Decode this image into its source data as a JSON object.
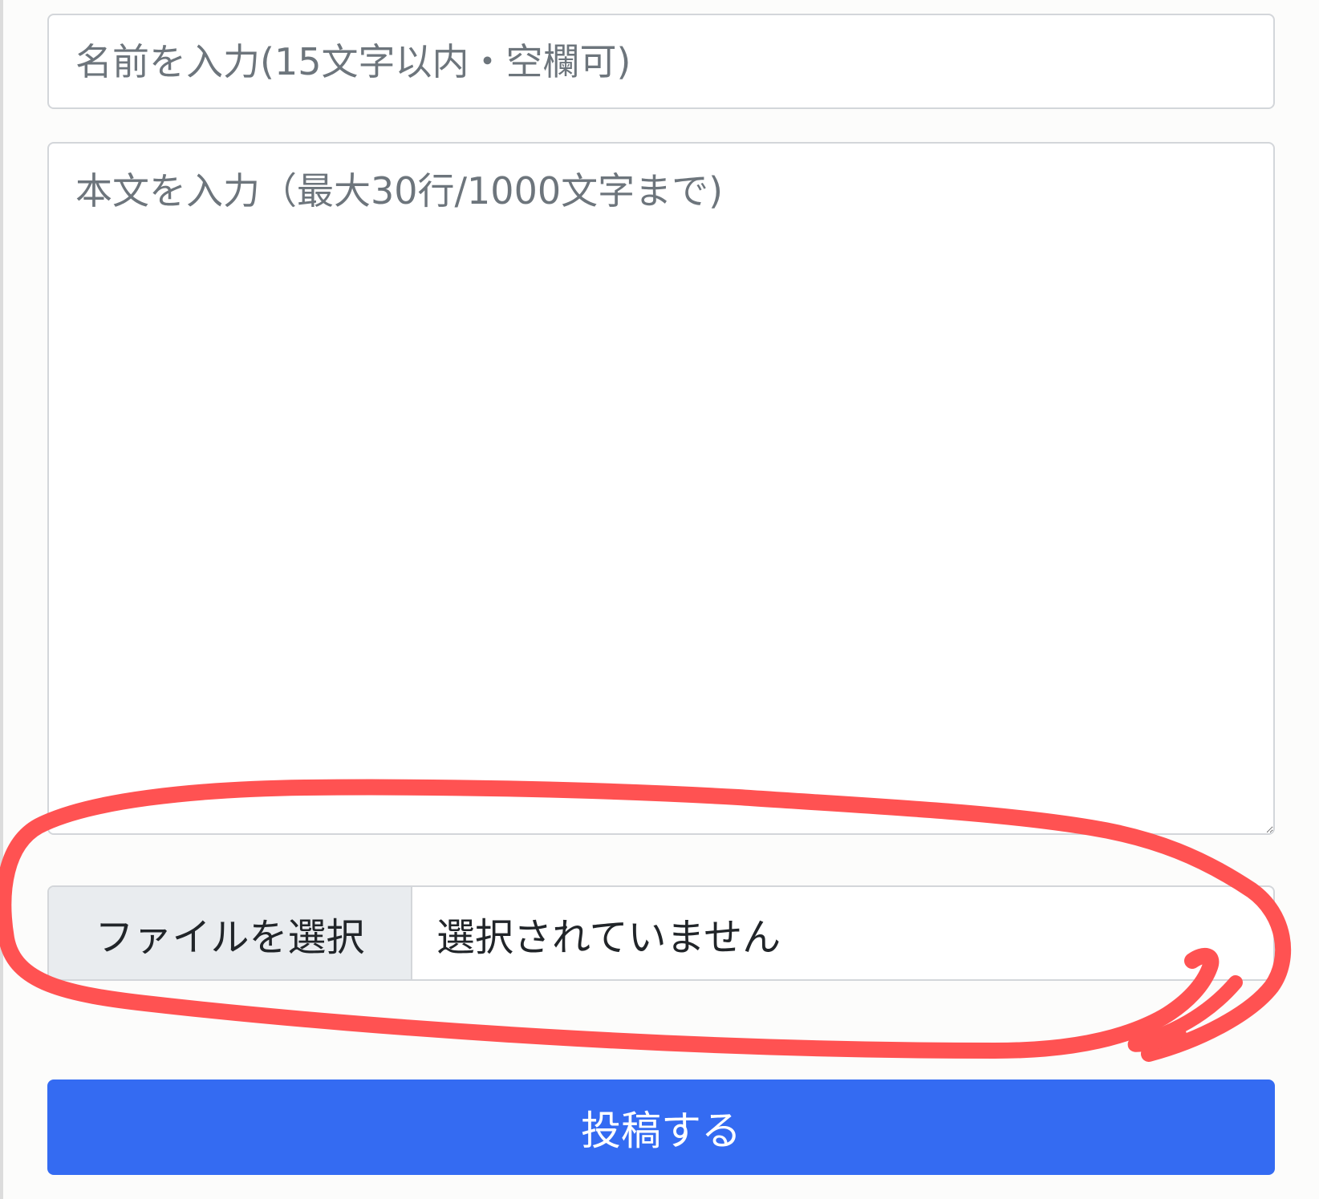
{
  "form": {
    "name_placeholder": "名前を入力(15文字以内・空欄可)",
    "body_placeholder": "本文を入力（最大30行/1000文字まで)",
    "file_button_label": "ファイルを選択",
    "file_status": "選択されていません",
    "submit_label": "投稿する"
  },
  "colors": {
    "submit_background": "#346bf2",
    "annotation_stroke": "#ff5252",
    "file_button_background": "#e9ecef"
  }
}
